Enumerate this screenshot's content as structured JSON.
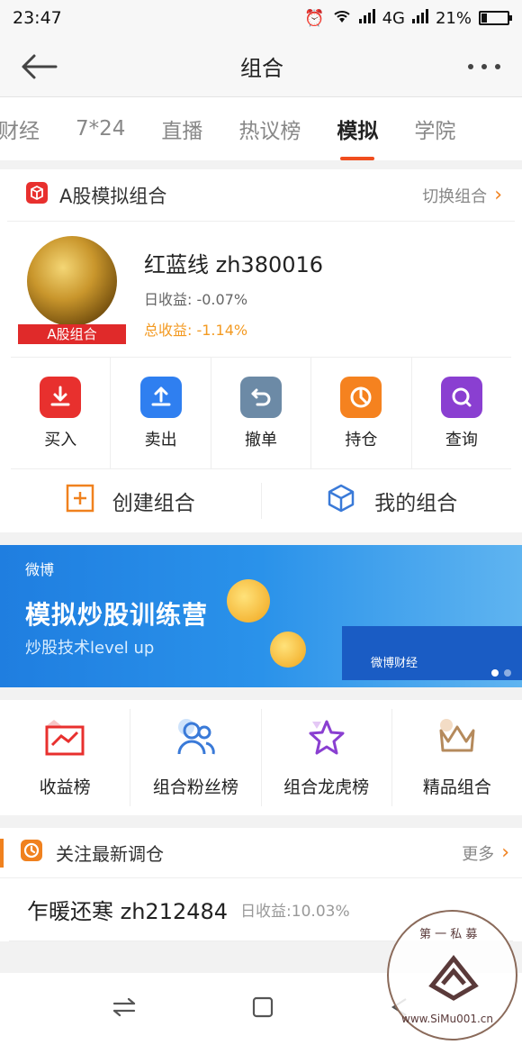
{
  "status_bar": {
    "time": "23:47",
    "network": "4G",
    "battery": "21%",
    "battery_level": 0.21
  },
  "nav": {
    "title": "组合"
  },
  "tabs": [
    {
      "label": "财经",
      "active": false
    },
    {
      "label": "7*24",
      "active": false
    },
    {
      "label": "直播",
      "active": false
    },
    {
      "label": "热议榜",
      "active": false
    },
    {
      "label": "模拟",
      "active": true
    },
    {
      "label": "学院",
      "active": false
    }
  ],
  "sim_card": {
    "title": "A股模拟组合",
    "switch_label": "切换组合",
    "portfolio": {
      "badge": "A股组合",
      "name": "红蓝线 zh380016",
      "daily_return": "日收益: -0.07%",
      "total_return": "总收益: -1.14%"
    },
    "actions": [
      {
        "label": "买入",
        "icon": "download-icon",
        "color": "#e8302e"
      },
      {
        "label": "卖出",
        "icon": "upload-icon",
        "color": "#2f7ff0"
      },
      {
        "label": "撤单",
        "icon": "undo-icon",
        "color": "#6c8aa6"
      },
      {
        "label": "持仓",
        "icon": "pie-icon",
        "color": "#f5821f"
      },
      {
        "label": "查询",
        "icon": "search-icon",
        "color": "#8a3fd1"
      }
    ],
    "create_label": "创建组合",
    "my_label": "我的组合"
  },
  "banner": {
    "logo_text": "微博",
    "title": "模拟炒股训练营",
    "subtitle": "炒股技术level up",
    "caption": "微博财经"
  },
  "ranks": [
    {
      "label": "收益榜",
      "icon": "trend-chart-icon"
    },
    {
      "label": "组合粉丝榜",
      "icon": "users-icon"
    },
    {
      "label": "组合龙虎榜",
      "icon": "star-icon"
    },
    {
      "label": "精品组合",
      "icon": "crown-icon"
    }
  ],
  "follow": {
    "title": "关注最新调仓",
    "more_label": "更多",
    "items": [
      {
        "name": "乍暖还寒 zh212484",
        "daily_return": "日收益:10.03%"
      }
    ]
  },
  "watermark": {
    "top": "第 一 私 募",
    "bottom": "www.SiMu001.cn"
  }
}
